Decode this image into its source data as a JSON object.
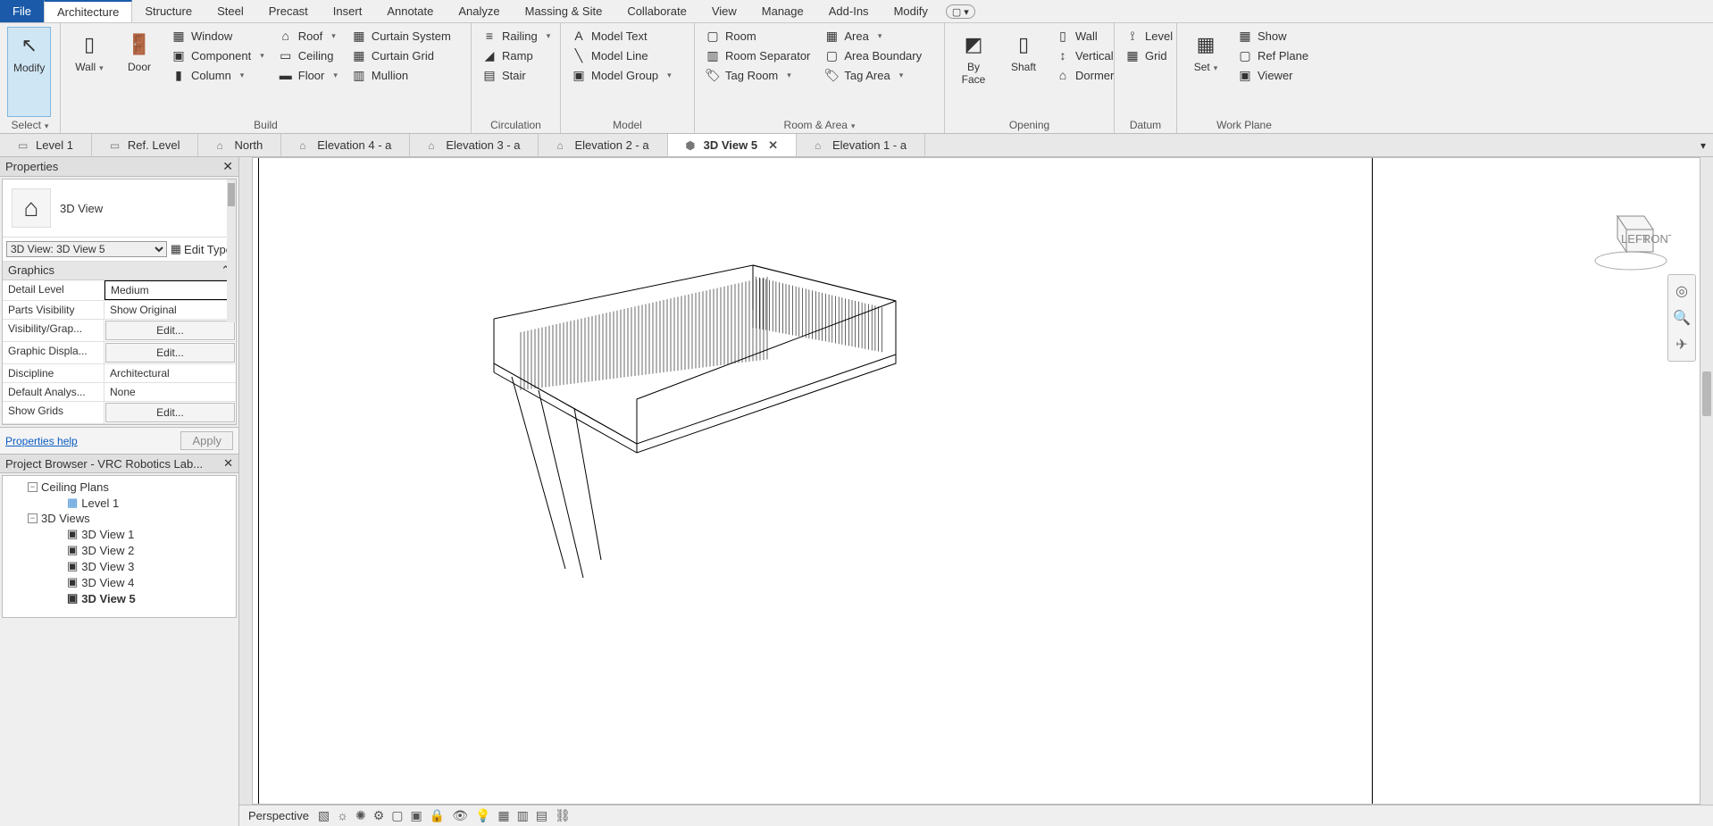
{
  "menu": {
    "file": "File",
    "architecture": "Architecture",
    "structure": "Structure",
    "steel": "Steel",
    "precast": "Precast",
    "insert": "Insert",
    "annotate": "Annotate",
    "analyze": "Analyze",
    "massing": "Massing & Site",
    "collaborate": "Collaborate",
    "view": "View",
    "manage": "Manage",
    "addins": "Add-Ins",
    "modify": "Modify"
  },
  "ribbon": {
    "select": {
      "modify": "Modify",
      "select": "Select"
    },
    "build": {
      "wall": "Wall",
      "door": "Door",
      "window": "Window",
      "component": "Component",
      "column": "Column",
      "roof": "Roof",
      "ceiling": "Ceiling",
      "floor": "Floor",
      "curtain_system": "Curtain  System",
      "curtain_grid": "Curtain  Grid",
      "mullion": "Mullion",
      "label": "Build"
    },
    "circulation": {
      "railing": "Railing",
      "ramp": "Ramp",
      "stair": "Stair",
      "label": "Circulation"
    },
    "model": {
      "model_text": "Model  Text",
      "model_line": "Model  Line",
      "model_group": "Model  Group",
      "label": "Model"
    },
    "roomarea": {
      "room": "Room",
      "room_sep": "Room  Separator",
      "tag_room": "Tag  Room",
      "area": "Area",
      "area_boundary": "Area  Boundary",
      "tag_area": "Tag  Area",
      "label": "Room & Area"
    },
    "opening": {
      "by_face": "By\nFace",
      "shaft": "Shaft",
      "wall": "Wall",
      "vertical": "Vertical",
      "dormer": "Dormer",
      "label": "Opening"
    },
    "datum": {
      "level": "Level",
      "grid": "Grid",
      "label": "Datum"
    },
    "workplane": {
      "set": "Set",
      "show": "Show",
      "ref_plane": "Ref  Plane",
      "viewer": "Viewer",
      "label": "Work Plane"
    }
  },
  "tabs": [
    "Level 1",
    "Ref. Level",
    "North",
    "Elevation 4 - a",
    "Elevation 3 - a",
    "Elevation 2 - a",
    "3D View 5",
    "Elevation 1 - a"
  ],
  "active_tab": "3D View 5",
  "properties": {
    "title": "Properties",
    "type": "3D View",
    "selector": "3D View: 3D View 5",
    "edittype": "Edit Type",
    "group": "Graphics",
    "rows": [
      {
        "k": "Detail Level",
        "v": "Medium",
        "sel": true
      },
      {
        "k": "Parts Visibility",
        "v": "Show Original"
      },
      {
        "k": "Visibility/Grap...",
        "v": "Edit...",
        "btn": true
      },
      {
        "k": "Graphic Displa...",
        "v": "Edit...",
        "btn": true
      },
      {
        "k": "Discipline",
        "v": "Architectural"
      },
      {
        "k": "Default Analys...",
        "v": "None"
      },
      {
        "k": "Show Grids",
        "v": "Edit...",
        "btn": true
      }
    ],
    "help": "Properties help",
    "apply": "Apply"
  },
  "browser": {
    "title": "Project Browser - VRC Robotics Lab...",
    "nodes": {
      "ceiling": "Ceiling Plans",
      "level1": "Level 1",
      "views3d": "3D Views",
      "v1": "3D View 1",
      "v2": "3D View 2",
      "v3": "3D View 3",
      "v4": "3D View 4",
      "v5": "3D View 5"
    }
  },
  "status": {
    "mode": "Perspective"
  }
}
